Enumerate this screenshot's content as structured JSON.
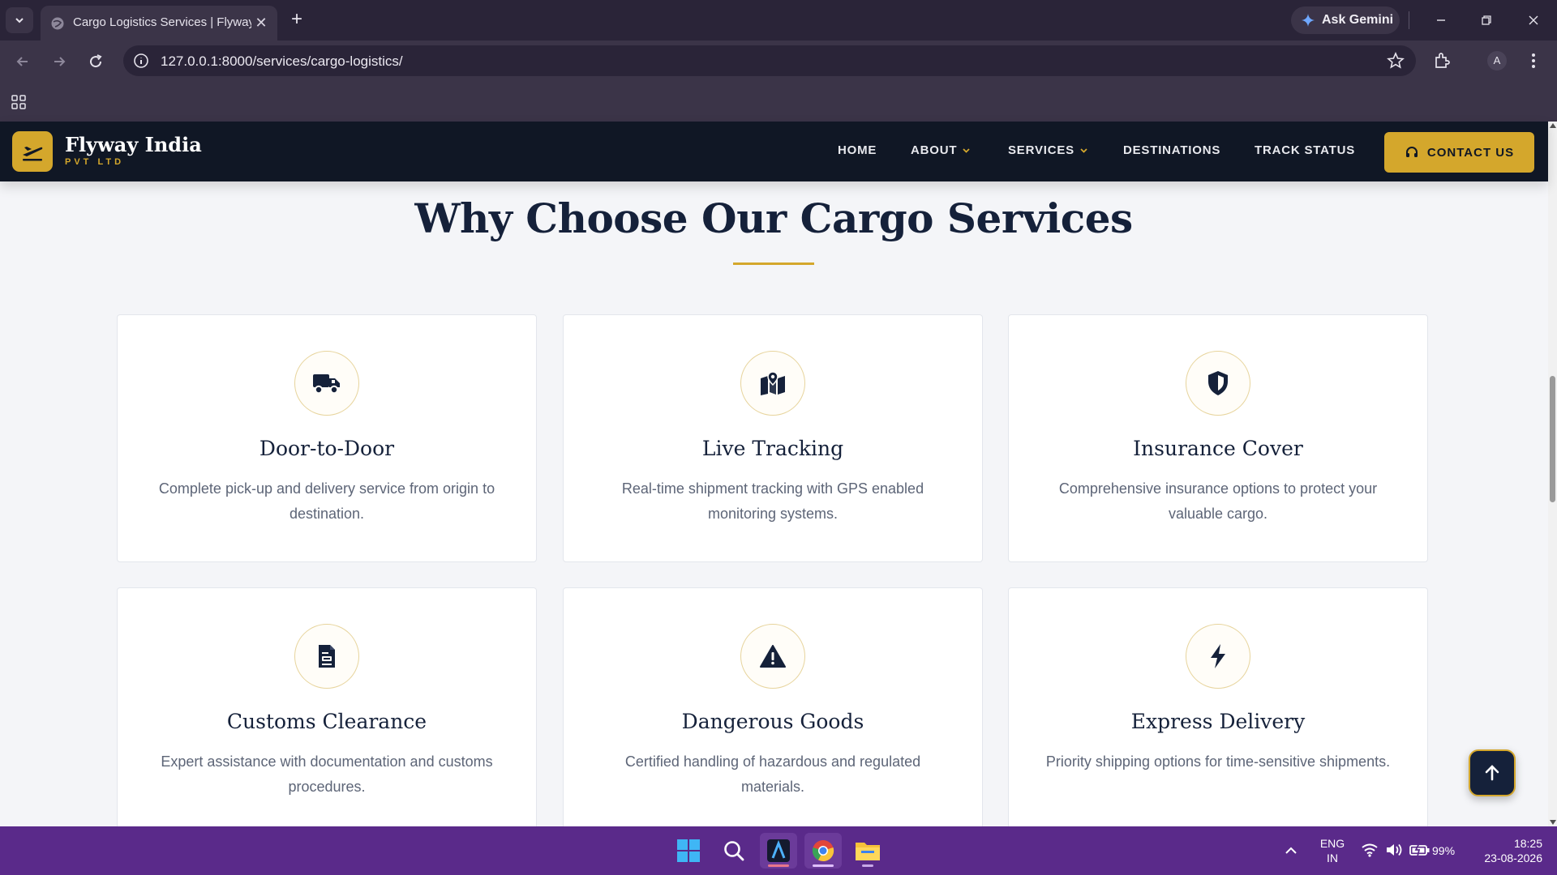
{
  "browser": {
    "tab_title": "Cargo Logistics Services | Flyway India",
    "url": "127.0.0.1:8000/services/cargo-logistics/",
    "gemini_label": "Ask Gemini",
    "avatar_letter": "A"
  },
  "header": {
    "brand_name": "Flyway India",
    "brand_sub": "PVT LTD",
    "nav": {
      "home": "HOME",
      "about": "ABOUT",
      "services": "SERVICES",
      "destinations": "DESTINATIONS",
      "track": "TRACK STATUS"
    },
    "contact_label": "CONTACT US"
  },
  "section": {
    "title": "Why Choose Our Cargo Services"
  },
  "features": [
    {
      "icon": "truck-icon",
      "title": "Door-to-Door",
      "desc": "Complete pick-up and delivery service from origin to destination."
    },
    {
      "icon": "map-pin-icon",
      "title": "Live Tracking",
      "desc": "Real-time shipment tracking with GPS enabled monitoring systems."
    },
    {
      "icon": "shield-icon",
      "title": "Insurance Cover",
      "desc": "Comprehensive insurance options to protect your valuable cargo."
    },
    {
      "icon": "document-icon",
      "title": "Customs Clearance",
      "desc": "Expert assistance with documentation and customs procedures."
    },
    {
      "icon": "warning-icon",
      "title": "Dangerous Goods",
      "desc": "Certified handling of hazardous and regulated materials."
    },
    {
      "icon": "bolt-icon",
      "title": "Express Delivery",
      "desc": "Priority shipping options for time-sensitive shipments."
    }
  ],
  "taskbar": {
    "lang": "ENG",
    "region": "IN",
    "battery": "99%",
    "time": "18:25",
    "date": "23-08-2026"
  },
  "colors": {
    "navy": "#15213a",
    "gold": "#d4a72c",
    "header_bg": "#101725",
    "taskbar": "#5a2a8a"
  }
}
